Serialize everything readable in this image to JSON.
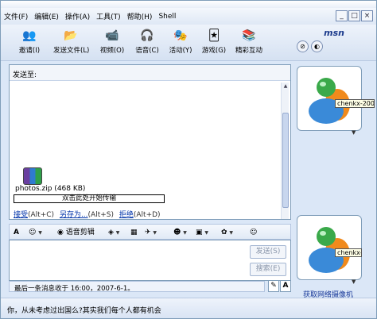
{
  "menu": [
    "文件(F)",
    "编辑(E)",
    "操作(A)",
    "工具(T)",
    "帮助(H)",
    "Shell"
  ],
  "window_buttons": [
    "_",
    "□",
    "×"
  ],
  "toolbar": [
    {
      "label": "邀请(I)",
      "icon": "invite-people-icon",
      "glyph": "👥"
    },
    {
      "label": "发送文件(L)",
      "icon": "send-file-icon",
      "glyph": "📂"
    },
    {
      "label": "视频(O)",
      "icon": "video-icon",
      "glyph": "📹"
    },
    {
      "label": "语音(C)",
      "icon": "voice-icon",
      "glyph": "🎧"
    },
    {
      "label": "活动(Y)",
      "icon": "activities-icon",
      "glyph": "🎭"
    },
    {
      "label": "游戏(G)",
      "icon": "games-icon",
      "glyph": "🃏"
    },
    {
      "label": "精彩互动",
      "icon": "interactive-icon",
      "glyph": "📚"
    }
  ],
  "brand": {
    "logo": "msn"
  },
  "conversation": {
    "to_label": "发送至:"
  },
  "transfer": {
    "file_name": "photos.zip (468 KB)",
    "prompt": "双击此处开始传输",
    "accept_label": "接受",
    "accept_hint": "(Alt+C)",
    "save_as_label": "另存为...",
    "save_as_hint": "(Alt+S)",
    "decline_label": "拒绝",
    "decline_hint": "(Alt+D)"
  },
  "format_toolbar": {
    "font_glyph": "A",
    "voice_clip_label": "语音剪辑"
  },
  "input": {
    "send_label": "发送(S)",
    "search_label": "搜索(E)"
  },
  "status": {
    "last_message": "最后一条消息收于 16:00，2007-6-1。"
  },
  "avatars": {
    "contact_name": "chenkx-200",
    "self_name": "chenkx-",
    "webcam_link": "获取网络摄像机"
  },
  "bottom_bar": {
    "text": "你，从未考虑过出国么?其实我们每个人都有机会"
  },
  "colors": {
    "accent": "#1b3a8c",
    "link": "#0033aa",
    "frame": "#7f9db9",
    "chrome": "#dbe7f7"
  }
}
